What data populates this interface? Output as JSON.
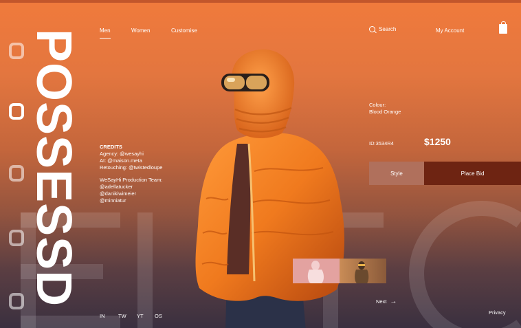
{
  "brand": {
    "word": "POSSESSD"
  },
  "nav": {
    "items": [
      {
        "label": "Men",
        "active": true
      },
      {
        "label": "Women",
        "active": false
      },
      {
        "label": "Customise",
        "active": false
      }
    ],
    "search_label": "Search",
    "account_label": "My Account",
    "cart_icon": "shopping-bag-icon"
  },
  "credits": {
    "heading": "CREDITS",
    "agency": "Agency: @wesayhi",
    "ai": "AI: @maison.meta",
    "retouching": "Retouching: @twistedloupe",
    "team_heading": "WeSayHi Production Team:",
    "team": [
      "@adellatucker",
      "@danikiwimeier",
      "@minniatur"
    ]
  },
  "product": {
    "colour_label": "Colour:",
    "colour_value": "Blood Orange",
    "id": "ID:3534R4",
    "price": "$1250",
    "style_button": "Style",
    "bid_button": "Place Bid"
  },
  "footer": {
    "next_label": "Next",
    "privacy_label": "Privacy",
    "social": [
      "IN",
      "TW",
      "YT",
      "OS"
    ]
  },
  "colors": {
    "accent": "#f07a3c",
    "bid_button": "#6e2412",
    "style_button": "#b0705c"
  }
}
